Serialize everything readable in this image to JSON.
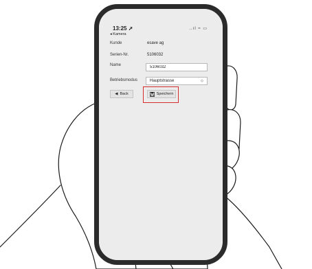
{
  "status": {
    "time": "13:25",
    "location_glyph": "➚",
    "back_app": "◂ Kamera",
    "icons": "..ıl ≈ ▭"
  },
  "form": {
    "customer_label": "Kunde",
    "customer_value": "esave ag",
    "serial_label": "Serien-Nr.",
    "serial_value": "5106032",
    "name_label": "Name",
    "name_value": "5106032",
    "mode_label": "Betriebsmodus",
    "mode_value": "Hauptstrasse",
    "mode_chevron": "◇"
  },
  "buttons": {
    "back_arrow": "◀",
    "back_label": "Back",
    "save_label": "Speichern"
  },
  "icons": {
    "save": "floppy-disk-icon"
  },
  "colors": {
    "highlight": "#d62b2b",
    "screen_bg": "#ececec",
    "phone_frame": "#2b2b2b"
  }
}
